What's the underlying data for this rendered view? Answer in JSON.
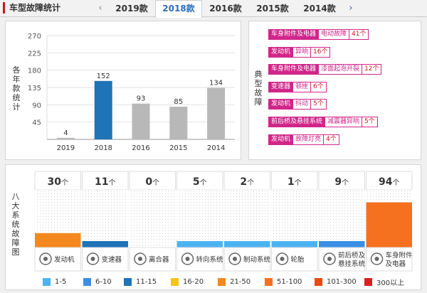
{
  "header": {
    "title": "车型故障统计",
    "tabs": [
      {
        "label": "2019款",
        "active": false
      },
      {
        "label": "2018款",
        "active": true
      },
      {
        "label": "2016款",
        "active": false
      },
      {
        "label": "2015款",
        "active": false
      },
      {
        "label": "2014款",
        "active": false
      }
    ],
    "prev_arrow": "‹",
    "next_arrow": "›"
  },
  "chart_data": {
    "type": "bar",
    "categories": [
      "2019",
      "2018",
      "2016",
      "2015",
      "2014"
    ],
    "values": [
      4,
      152,
      93,
      85,
      134
    ],
    "highlight_index": 1,
    "yticks": [
      45,
      90,
      135,
      180,
      225,
      270
    ],
    "ylim": [
      0,
      270
    ],
    "ylabel": "各年款统计",
    "grid": true,
    "colors": {
      "default": "#b8b8b8",
      "highlight": "#1f73b7"
    }
  },
  "faults": {
    "label": "典型故障",
    "items": [
      {
        "category": "车身附件及电器",
        "desc": "电动故障",
        "count": "41个"
      },
      {
        "category": "发动机",
        "desc": "异响",
        "count": "16个"
      },
      {
        "category": "车身附件及电器",
        "desc": "漆面起泡开裂",
        "count": "12个"
      },
      {
        "category": "变速器",
        "desc": "顿挫",
        "count": "6个"
      },
      {
        "category": "发动机",
        "desc": "抖动",
        "count": "5个"
      },
      {
        "category": "前后桥及悬挂系统",
        "desc": "减震器异响",
        "count": "5个"
      },
      {
        "category": "发动机",
        "desc": "故障灯亮",
        "count": "4个"
      }
    ]
  },
  "systems": {
    "label": "八大系统故障图",
    "unit": "个",
    "items": [
      {
        "name": "发动机",
        "count": "30",
        "icon": "engine-icon",
        "color": "#f5871f"
      },
      {
        "name": "变速器",
        "count": "11",
        "icon": "gearbox-icon",
        "color": "#1f73b7"
      },
      {
        "name": "离合器",
        "count": "0",
        "icon": "clutch-icon",
        "color": "#4bb4f0"
      },
      {
        "name": "转向系统",
        "count": "5",
        "icon": "steering-icon",
        "color": "#4bb4f0"
      },
      {
        "name": "制动系统",
        "count": "2",
        "icon": "brake-icon",
        "color": "#4bb4f0"
      },
      {
        "name": "轮胎",
        "count": "1",
        "icon": "tire-icon",
        "color": "#4bb4f0"
      },
      {
        "name": "前后桥及悬挂系统",
        "count": "9",
        "icon": "suspension-icon",
        "color": "#3a8ee6"
      },
      {
        "name": "车身附件及电器",
        "count": "94",
        "icon": "body-electrical-icon",
        "color": "#f5701f"
      }
    ]
  },
  "legend": [
    {
      "label": "1-5",
      "color": "#4bb4f0"
    },
    {
      "label": "6-10",
      "color": "#3a8ee6"
    },
    {
      "label": "11-15",
      "color": "#1f73b7"
    },
    {
      "label": "16-20",
      "color": "#f5c518"
    },
    {
      "label": "21-50",
      "color": "#f5871f"
    },
    {
      "label": "51-100",
      "color": "#f5701f"
    },
    {
      "label": "101-300",
      "color": "#e84a12"
    },
    {
      "label": "300以上",
      "color": "#d91f1f"
    }
  ]
}
